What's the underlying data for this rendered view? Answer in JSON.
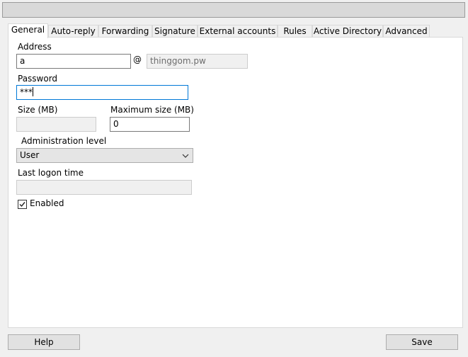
{
  "tabs": [
    "General",
    "Auto-reply",
    "Forwarding",
    "Signature",
    "External accounts",
    "Rules",
    "Active Directory",
    "Advanced"
  ],
  "general": {
    "address_label": "Address",
    "address_value": "a",
    "at_sign": "@",
    "domain_value": "thinggom.pw",
    "password_label": "Password",
    "password_value": "***",
    "size_label": "Size (MB)",
    "size_value": "",
    "max_size_label": "Maximum size (MB)",
    "max_size_value": "0",
    "admin_level_label": "Administration level",
    "admin_level_value": "User",
    "last_logon_label": "Last logon time",
    "last_logon_value": "",
    "enabled_label": "Enabled",
    "enabled_checked": true
  },
  "buttons": {
    "help": "Help",
    "save": "Save"
  },
  "colors": {
    "focus_border": "#0078d7",
    "panel_bg": "#ffffff",
    "window_bg": "#f0f0f0"
  }
}
